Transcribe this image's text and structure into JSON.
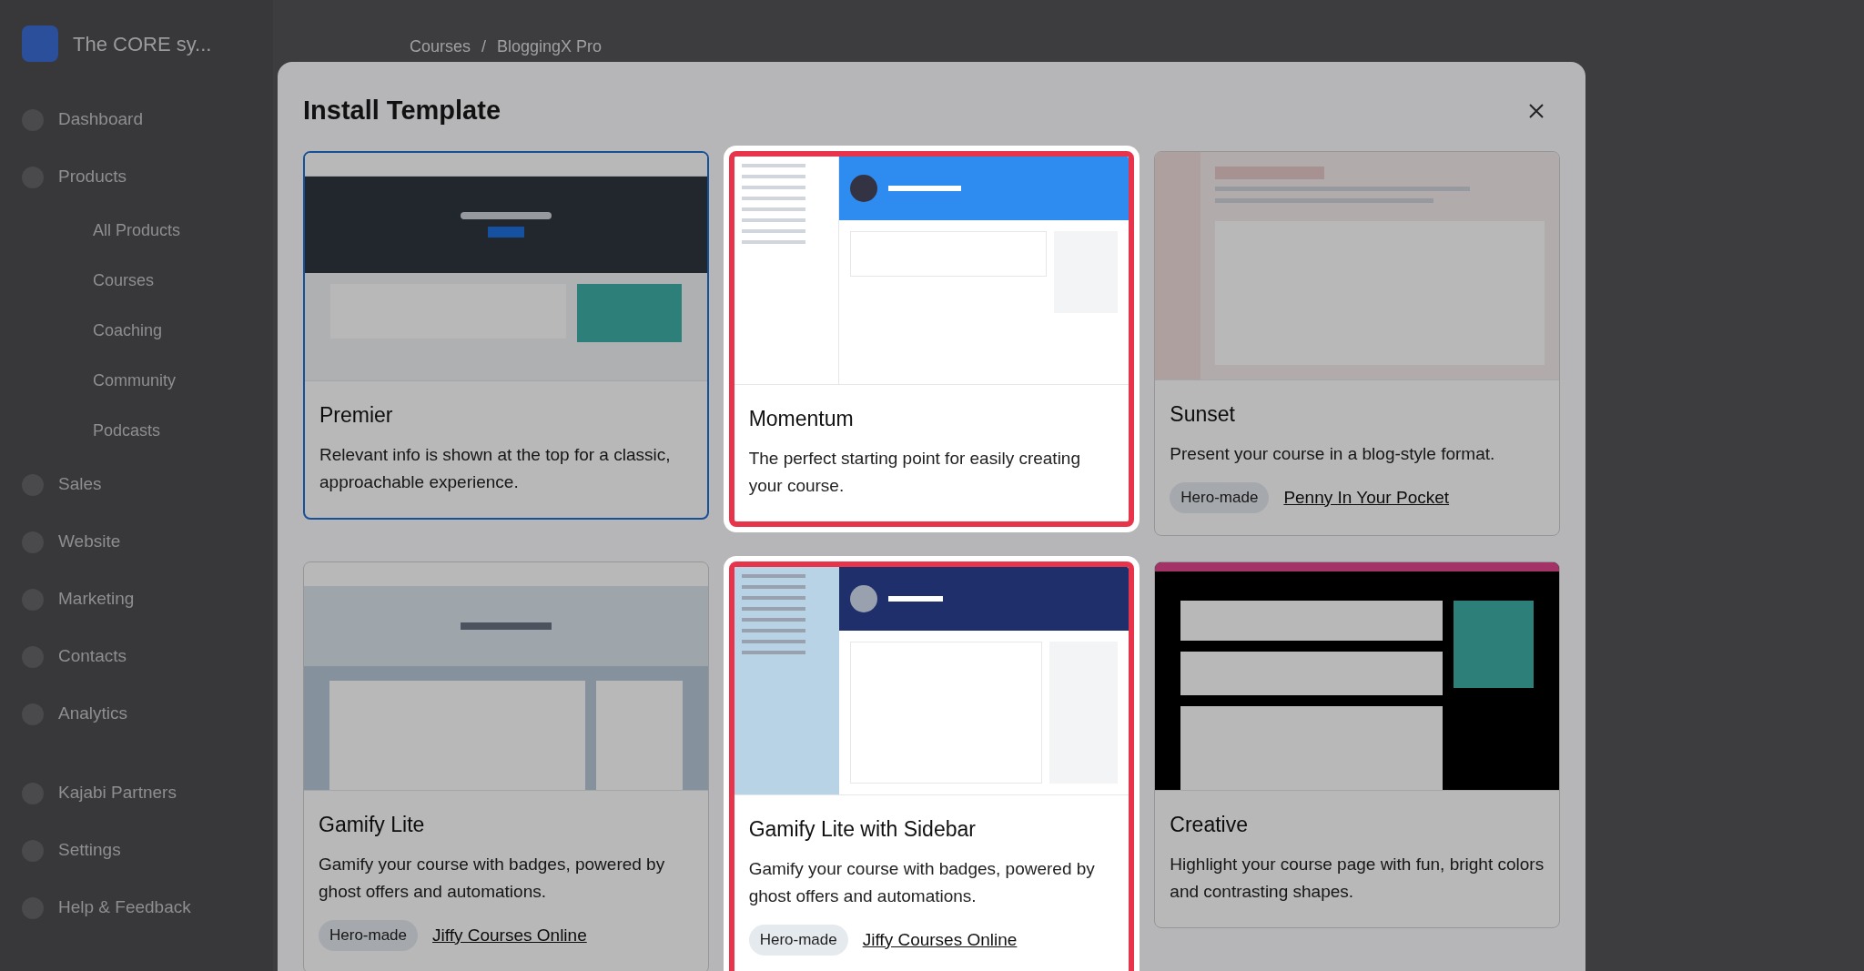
{
  "app": {
    "site_name": "The CORE sy...",
    "breadcrumb": [
      "Courses",
      "BloggingX Pro"
    ],
    "breadcrumb_separator": "/",
    "sidebar": [
      {
        "label": "Dashboard"
      },
      {
        "label": "Products",
        "children": [
          {
            "label": "All Products"
          },
          {
            "label": "Courses"
          },
          {
            "label": "Coaching"
          },
          {
            "label": "Community"
          },
          {
            "label": "Podcasts"
          }
        ]
      },
      {
        "label": "Sales"
      },
      {
        "label": "Website"
      },
      {
        "label": "Marketing"
      },
      {
        "label": "Contacts"
      },
      {
        "label": "Analytics"
      },
      {
        "label": "Kajabi Partners"
      },
      {
        "label": "Settings"
      },
      {
        "label": "Help & Feedback"
      }
    ]
  },
  "dialog": {
    "title": "Install Template",
    "templates": [
      {
        "kind": "premier",
        "name": "Premier",
        "description": "Relevant info is shown at the top for a classic, approachable experience.",
        "selected": true,
        "highlighted": false
      },
      {
        "kind": "momentum",
        "name": "Momentum",
        "description": "The perfect starting point for easily creating your course.",
        "selected": false,
        "highlighted": true
      },
      {
        "kind": "sunset",
        "name": "Sunset",
        "description": "Present your course in a blog-style format.",
        "badge": "Hero-made",
        "author": "Penny In Your Pocket",
        "selected": false,
        "highlighted": false
      },
      {
        "kind": "gamify",
        "name": "Gamify Lite",
        "description": "Gamify your course with badges, powered by ghost offers and automations.",
        "badge": "Hero-made",
        "author": "Jiffy Courses Online",
        "selected": false,
        "highlighted": false
      },
      {
        "kind": "gamify-sidebar",
        "name": "Gamify Lite with Sidebar",
        "description": "Gamify your course with badges, powered by ghost offers and automations.",
        "badge": "Hero-made",
        "author": "Jiffy Courses Online",
        "selected": false,
        "highlighted": true
      },
      {
        "kind": "creative",
        "name": "Creative",
        "description": "Highlight your course page with fun, bright colors and contrasting shapes.",
        "selected": false,
        "highlighted": false
      }
    ]
  }
}
